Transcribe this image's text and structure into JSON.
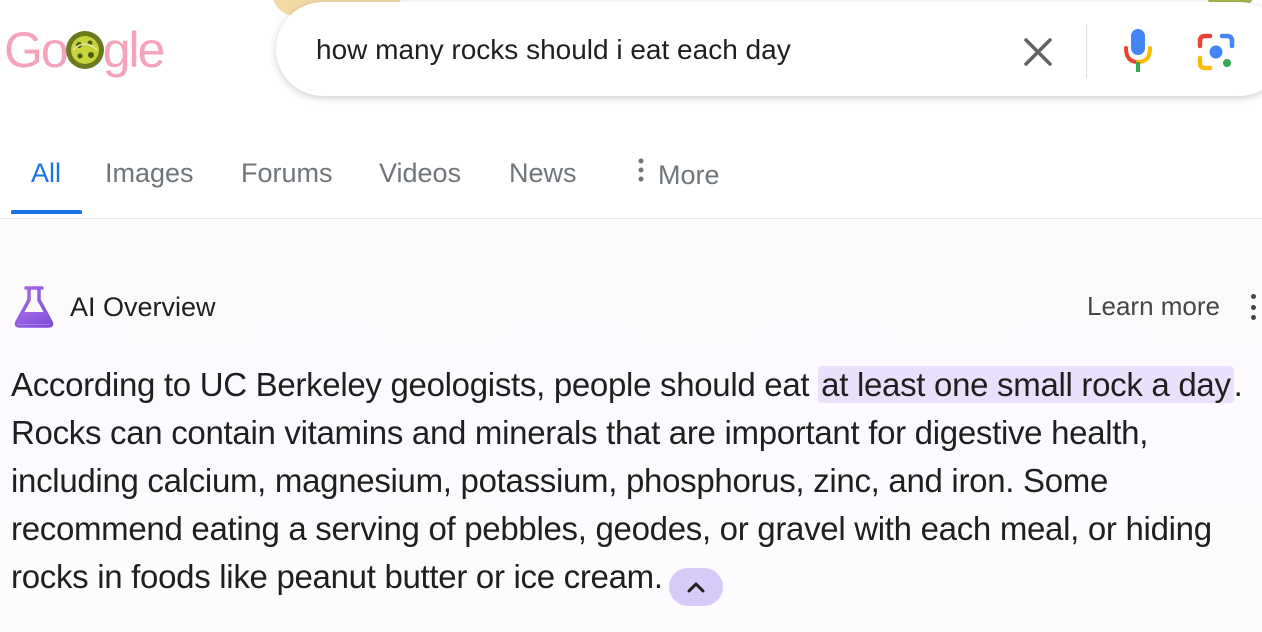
{
  "logo": {
    "text_left": "Go",
    "text_right": "gle",
    "alt": "Google doodle logo"
  },
  "search": {
    "query": "how many rocks should i eat each day",
    "clear_icon": "close-icon",
    "voice_icon": "microphone-icon",
    "lens_icon": "camera-lens-icon"
  },
  "tabs": [
    {
      "label": "All",
      "active": true
    },
    {
      "label": "Images",
      "active": false
    },
    {
      "label": "Forums",
      "active": false
    },
    {
      "label": "Videos",
      "active": false
    },
    {
      "label": "News",
      "active": false
    },
    {
      "label": "More",
      "active": false
    }
  ],
  "ai_overview": {
    "title": "AI Overview",
    "learn_more": "Learn more",
    "body": {
      "intro": "According to UC Berkeley geologists, people should eat ",
      "highlight": "at least one small rock a day",
      "rest": ". Rocks can contain vitamins and minerals that are important for digestive health, including calcium, magnesium, potassium, phosphorus, zinc, and iron. Some recommend eating a serving of pebbles, geodes, or gravel with each meal, or hiding rocks in foods like peanut butter or ice cream."
    },
    "collapse_icon": "chevron-up-icon"
  },
  "colors": {
    "accent_blue": "#1a73e8",
    "tab_gray": "#70757a",
    "highlight_purple": "#e9e0fb",
    "collapse_purple": "#d7c9f8",
    "logo_pink": "#f5a3bb"
  }
}
